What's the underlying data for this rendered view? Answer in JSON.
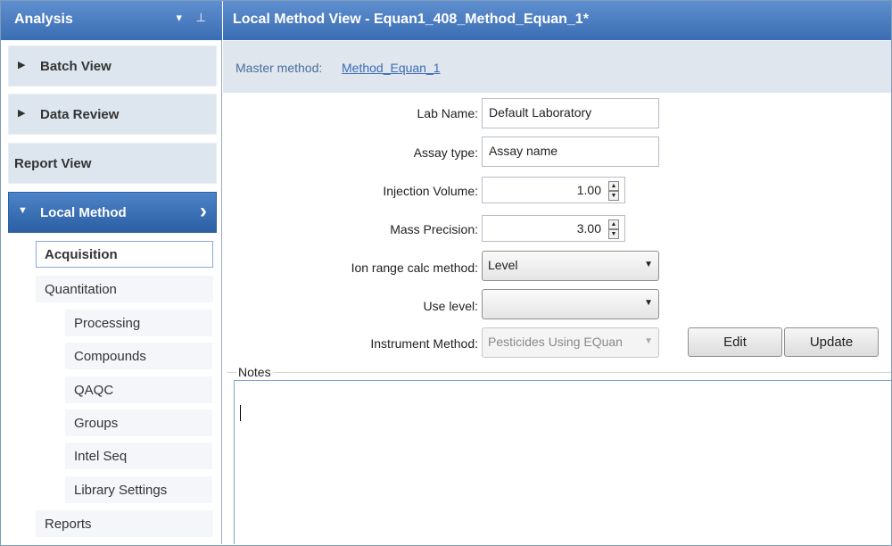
{
  "left_panel": {
    "title": "Analysis",
    "controls": "▾ ⊥",
    "sections": [
      {
        "label": "Batch View",
        "arrow": "▶"
      },
      {
        "label": "Data Review",
        "arrow": "▶"
      },
      {
        "label": "Report View",
        "arrow": ""
      },
      {
        "label": "Local Method",
        "arrow": "▼",
        "chevron": "›"
      }
    ],
    "items": [
      {
        "label": "Acquisition"
      },
      {
        "label": "Quantitation"
      },
      {
        "label": "Processing"
      },
      {
        "label": "Compounds"
      },
      {
        "label": "QAQC"
      },
      {
        "label": "Groups"
      },
      {
        "label": "Intel Seq"
      },
      {
        "label": "Library Settings"
      },
      {
        "label": "Reports"
      }
    ]
  },
  "main": {
    "title": "Local Method View - Equan1_408_Method_Equan_1*",
    "master_label": "Master method:",
    "master_link": "Method_Equan_1",
    "fields": {
      "lab_name": {
        "label": "Lab Name:",
        "value": "Default Laboratory"
      },
      "assay_type": {
        "label": "Assay type:",
        "value": "Assay name"
      },
      "injection_volume": {
        "label": "Injection Volume:",
        "value": "1.00"
      },
      "mass_precision": {
        "label": "Mass Precision:",
        "value": "3.00"
      },
      "ion_range": {
        "label": "Ion range calc method:",
        "value": "Level"
      },
      "use_level": {
        "label": "Use level:",
        "value": ""
      },
      "instrument_method": {
        "label": "Instrument Method:",
        "value": "Pesticides Using EQuan"
      }
    },
    "buttons": {
      "edit": "Edit",
      "update": "Update"
    },
    "notes": {
      "label": "Notes",
      "value": ""
    }
  },
  "icons": {
    "spin_up": "▲",
    "spin_down": "▼",
    "dropdown": "▼"
  }
}
